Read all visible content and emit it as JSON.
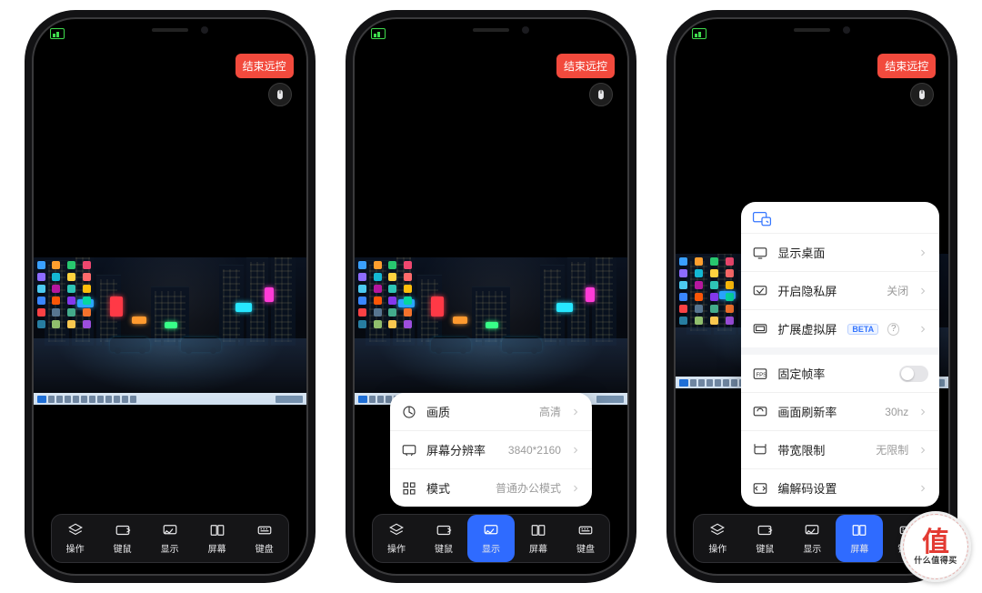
{
  "common": {
    "end_remote_label": "结束远控",
    "toolbar": [
      {
        "id": "ops",
        "label": "操作"
      },
      {
        "id": "mouse",
        "label": "键鼠"
      },
      {
        "id": "display",
        "label": "显示"
      },
      {
        "id": "screen",
        "label": "屏幕"
      },
      {
        "id": "keyboard",
        "label": "键盘"
      }
    ]
  },
  "phones": {
    "p1": {
      "active_tab": null
    },
    "p2": {
      "active_tab": "display",
      "panel": {
        "rows": [
          {
            "label": "画质",
            "value": "高清"
          },
          {
            "label": "屏幕分辨率",
            "value": "3840*2160"
          },
          {
            "label": "模式",
            "value": "普通办公模式"
          }
        ]
      }
    },
    "p3": {
      "active_tab": "screen",
      "panel": {
        "rows": [
          {
            "label": "显示桌面",
            "value": null,
            "type": "nav"
          },
          {
            "label": "开启隐私屏",
            "value": "关闭",
            "type": "nav"
          },
          {
            "label": "扩展虚拟屏",
            "value": null,
            "type": "nav",
            "beta": "BETA"
          },
          {
            "label": "固定帧率",
            "value": null,
            "type": "toggle",
            "toggle": false
          },
          {
            "label": "画面刷新率",
            "value": "30hz",
            "type": "nav"
          },
          {
            "label": "带宽限制",
            "value": "无限制",
            "type": "nav"
          },
          {
            "label": "编解码设置",
            "value": null,
            "type": "nav"
          }
        ]
      }
    }
  },
  "watermark": {
    "big": "值",
    "small": "什么值得买"
  },
  "colors": {
    "accent_red": "#f24a3d",
    "accent_blue": "#2f6bff",
    "panel_blue": "#3576ff"
  },
  "desk_icon_colors": [
    "#3aa0ff",
    "#ff9f2e",
    "#28c76f",
    "#ef476f",
    "#8d6cff",
    "#14b8d4",
    "#ffd23f",
    "#ff6b6b",
    "#4cc9f0",
    "#b5179e",
    "#2ec4b6",
    "#ffbe0b",
    "#3a86ff",
    "#fb5607",
    "#8338ec",
    "#06d6a0",
    "#f94144",
    "#577590",
    "#43aa8b",
    "#f3722c",
    "#277da1",
    "#90be6d",
    "#f9c74f",
    "#9d4edd"
  ]
}
